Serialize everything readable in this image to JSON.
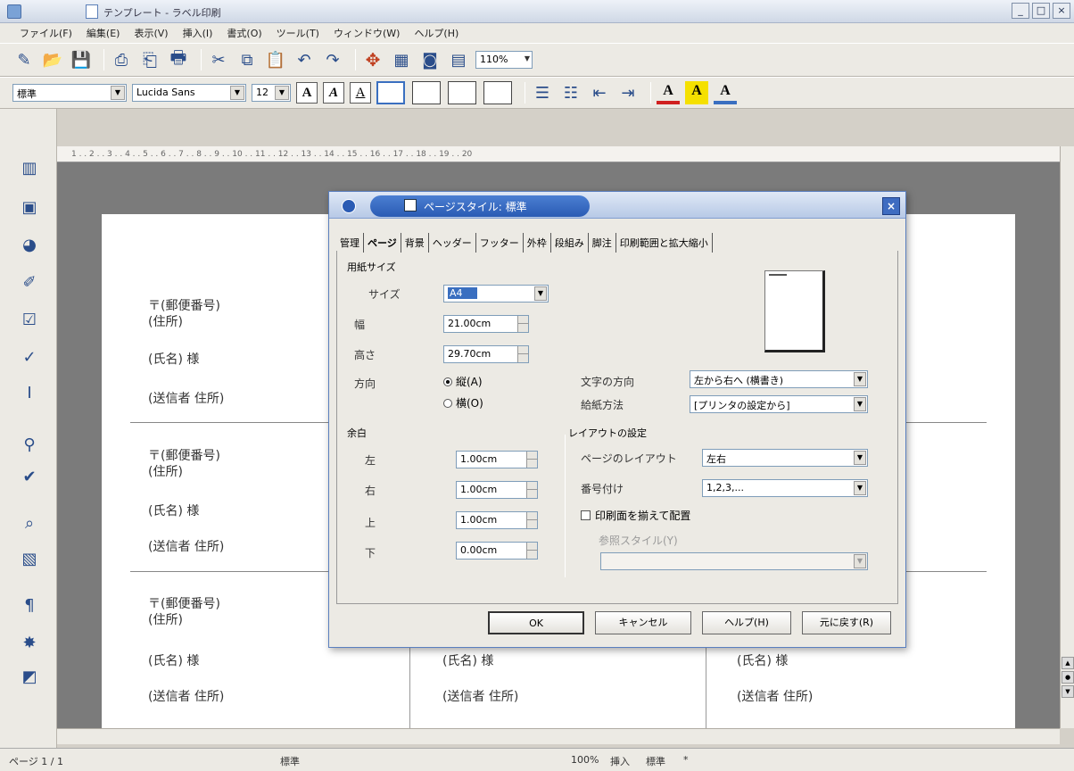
{
  "window": {
    "title": "テンプレート - ラベル印刷",
    "buttons": [
      "_",
      "□",
      "×"
    ]
  },
  "menu": [
    "ファイル(F)",
    "編集(E)",
    "表示(V)",
    "挿入(I)",
    "書式(O)",
    "ツール(T)",
    "ウィンドウ(W)",
    "ヘルプ(H)"
  ],
  "toolbar": {
    "zoom": "110%",
    "font_style": "標準",
    "font_name": "Lucida Sans",
    "font_size": "12"
  },
  "ruler": "1 . . 2 . . 3 . . 4 . . 5 . . 6 . . 7 . . 8 . . 9 . . 10 . . 11 . . 12 . . 13 . . 14 . . 15 . . 16 . . 17 . . 18 . . 19 . . 20",
  "labels": [
    {
      "zip": "〒(郵便番号)",
      "addr": "(住所)",
      "name": "(氏名) 様",
      "sender": "(送信者 住所)"
    },
    {
      "zip": "〒(郵便番号)",
      "addr": "(住所)",
      "name": "(氏名) 様",
      "sender": "(送信者 住所)"
    },
    {
      "zip": "〒(郵便番号)",
      "addr": "(住所)",
      "name": "(氏名) 様",
      "sender": "(送信者 住所)"
    }
  ],
  "labels_col2": [
    {
      "name": "(氏名) 様",
      "sender": "(送信者 住所)"
    }
  ],
  "labels_col3": [
    {
      "name": "(氏名) 様",
      "sender": "(送信者 住所)"
    }
  ],
  "status": {
    "page": "ページ 1 / 1",
    "style": "標準",
    "zoom": "100%",
    "mode1": "挿入",
    "mode2": "標準",
    "mode3": "*"
  },
  "dialog": {
    "title": "ページスタイル: 標準",
    "close": "×",
    "tabs": [
      "管理",
      "ページ",
      "背景",
      "ヘッダー",
      "フッター",
      "外枠",
      "段組み",
      "脚注",
      "印刷範囲と拡大縮小"
    ],
    "paper_group": "用紙サイズ",
    "format_label": "サイズ",
    "format_value": "A4",
    "width_label": "幅",
    "width_value": "21.00cm",
    "height_label": "高さ",
    "height_value": "29.70cm",
    "orientation_label": "方向",
    "portrait": "縦(A)",
    "landscape": "横(O)",
    "text_dir_label": "文字の方向",
    "text_dir_value": "左から右へ (横書き)",
    "paper_tray_label": "給紙方法",
    "paper_tray_value": "[プリンタの設定から]",
    "margins_group": "余白",
    "left_label": "左",
    "left_value": "1.00cm",
    "right_label": "右",
    "right_value": "1.00cm",
    "top_label": "上",
    "top_value": "1.00cm",
    "bottom_label": "下",
    "bottom_value": "0.00cm",
    "layout_group": "レイアウトの設定",
    "page_layout_label": "ページのレイアウト",
    "page_layout_value": "左右",
    "numbering_label": "番号付け",
    "numbering_value": "1,2,3,...",
    "register_true": "印刷面を揃えて配置",
    "ref_style_label": "参照スタイル(Y)",
    "ref_style_value": "",
    "ok": "OK",
    "cancel": "キャンセル",
    "help": "ヘルプ(H)",
    "reset": "元に戻す(R)"
  }
}
